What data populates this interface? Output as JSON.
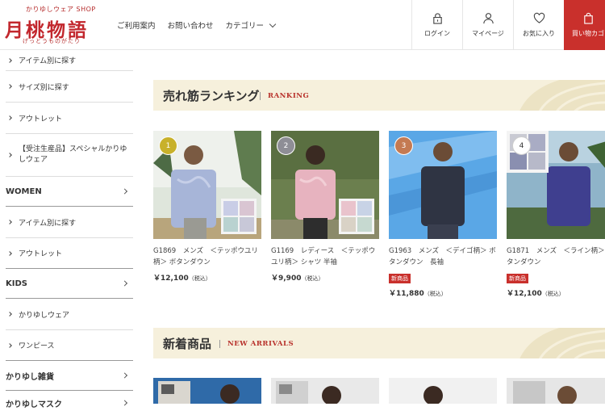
{
  "header": {
    "logo_tagline": "かりゆしウェア SHOP",
    "logo_name": "月桃物語",
    "logo_reading": "げっとうものがたり",
    "nav": {
      "guide": "ご利用案内",
      "contact": "お問い合わせ",
      "category": "カテゴリー"
    },
    "util": {
      "login": "ログイン",
      "mypage": "マイページ",
      "favorites": "お気に入り",
      "cart": "買い物カゴ"
    }
  },
  "sidebar": {
    "men_items": [
      "アイテム別に探す",
      "サイズ別に探す",
      "アウトレット",
      "【受注生産品】スペシャルかりゆしウェア"
    ],
    "women": {
      "label": "WOMEN",
      "items": [
        "アイテム別に探す",
        "アウトレット"
      ]
    },
    "kids": {
      "label": "KIDS",
      "items": [
        "かりゆしウェア",
        "ワンピース"
      ]
    },
    "goods": {
      "label": "かりゆし雑貨"
    },
    "mask": {
      "label": "かりゆしマスク"
    }
  },
  "ranking": {
    "title_jp": "売れ筋ランキング",
    "title_en": "RANKING",
    "products": [
      {
        "rank": "1",
        "rank_color": "#c8b12a",
        "name": "G1869　メンズ　＜テッポウユリ柄＞ ボタンダウン",
        "badge": "",
        "price": "￥12,100",
        "tax": "（税込）"
      },
      {
        "rank": "2",
        "rank_color": "#8e8e96",
        "name": "G1169　レディース　＜テッポウユリ柄＞ シャツ 半袖",
        "badge": "",
        "price": "￥9,900",
        "tax": "（税込）"
      },
      {
        "rank": "3",
        "rank_color": "#c47a52",
        "name": "G1963　メンズ　＜デイゴ柄＞ ボタンダウン　長袖",
        "badge": "新商品",
        "price": "￥11,880",
        "tax": "（税込）"
      },
      {
        "rank": "4",
        "rank_color": "#ffffff",
        "name": "G1871　メンズ　＜ライン柄＞ ボタンダウン",
        "badge": "新商品",
        "price": "￥12,100",
        "tax": "（税込）"
      }
    ]
  },
  "arrivals": {
    "title_jp": "新着商品",
    "title_en": "NEW ARRIVALS"
  },
  "colors": {
    "accent": "#c9302c",
    "section_bg": "#f6f0dc"
  }
}
